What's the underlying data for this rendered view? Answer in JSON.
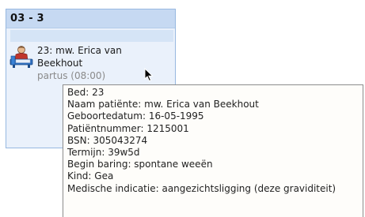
{
  "room": {
    "title": "03 - 3"
  },
  "patient": {
    "line1": "23: mw. Erica van",
    "line2": "Beekhout",
    "line3": "partus (08:00)",
    "icon": "patient-bed-icon"
  },
  "tooltip": {
    "lines": [
      "Bed: 23",
      "Naam patiënte: mw. Erica van Beekhout",
      "Geboortedatum: 16-05-1995",
      "Patiëntnummer: 1215001",
      "BSN: 305043274",
      "Termijn: 39w5d",
      "Begin baring: spontane weeën",
      "Kind: Gea",
      "Medische indicatie: aangezichtsligging (deze graviditeit)"
    ]
  },
  "colors": {
    "card_bg": "#eaf1fb",
    "card_border": "#97b8e0",
    "header_bg": "#c6d9f2",
    "tooltip_bg": "#fefdfa",
    "tooltip_border": "#8c8c8c"
  }
}
